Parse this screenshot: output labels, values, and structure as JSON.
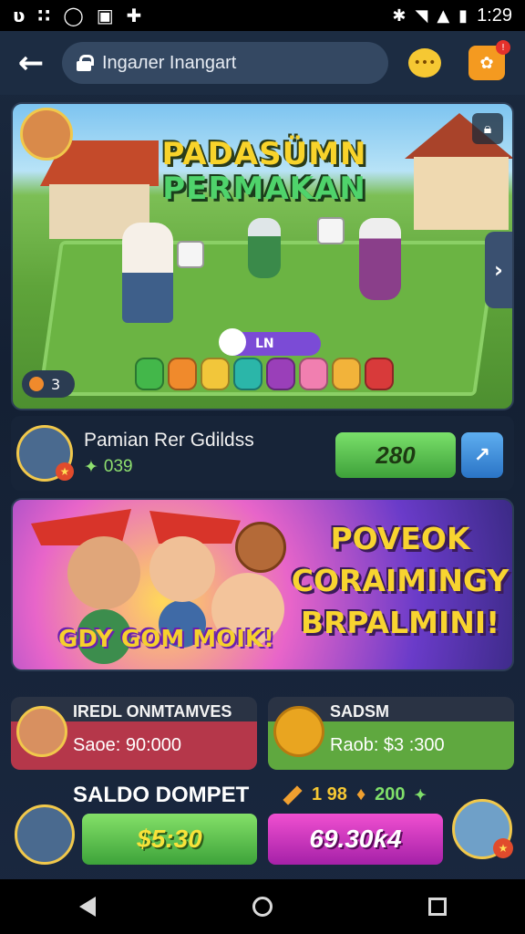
{
  "status_bar": {
    "time": "1:29"
  },
  "app_bar": {
    "search_text": "Ingaлer Inangart"
  },
  "hero": {
    "title_line1": "PADASÜMN",
    "title_line2": "PERMAKAN",
    "pill_label": "LN",
    "counter": "3",
    "coin_colors": [
      "#43b74a",
      "#f08a2c",
      "#f2c63a",
      "#2bb6a9",
      "#9a3fb9",
      "#f17fb0",
      "#f2b33a",
      "#d83a3a"
    ]
  },
  "player": {
    "name": "Pamian Rer Gdildss",
    "score": "039",
    "action_value": "280"
  },
  "banner": {
    "headline_1": "POVEOK",
    "headline_2": "CORAIMINGY",
    "headline_3": "BRPALMINI!",
    "sub": "GDY GOM MOIK!"
  },
  "cards": [
    {
      "title": "IREDL ONMTAMVES",
      "value": "Saoe: 90:000"
    },
    {
      "title": "SADSM",
      "value": "Raob: $3 :300"
    }
  ],
  "wallet": {
    "title": "SALDO DOMPET",
    "stat_1": "1 98",
    "stat_2": "200",
    "button_1": "$5:30",
    "button_2": "69.30ƙ4"
  }
}
